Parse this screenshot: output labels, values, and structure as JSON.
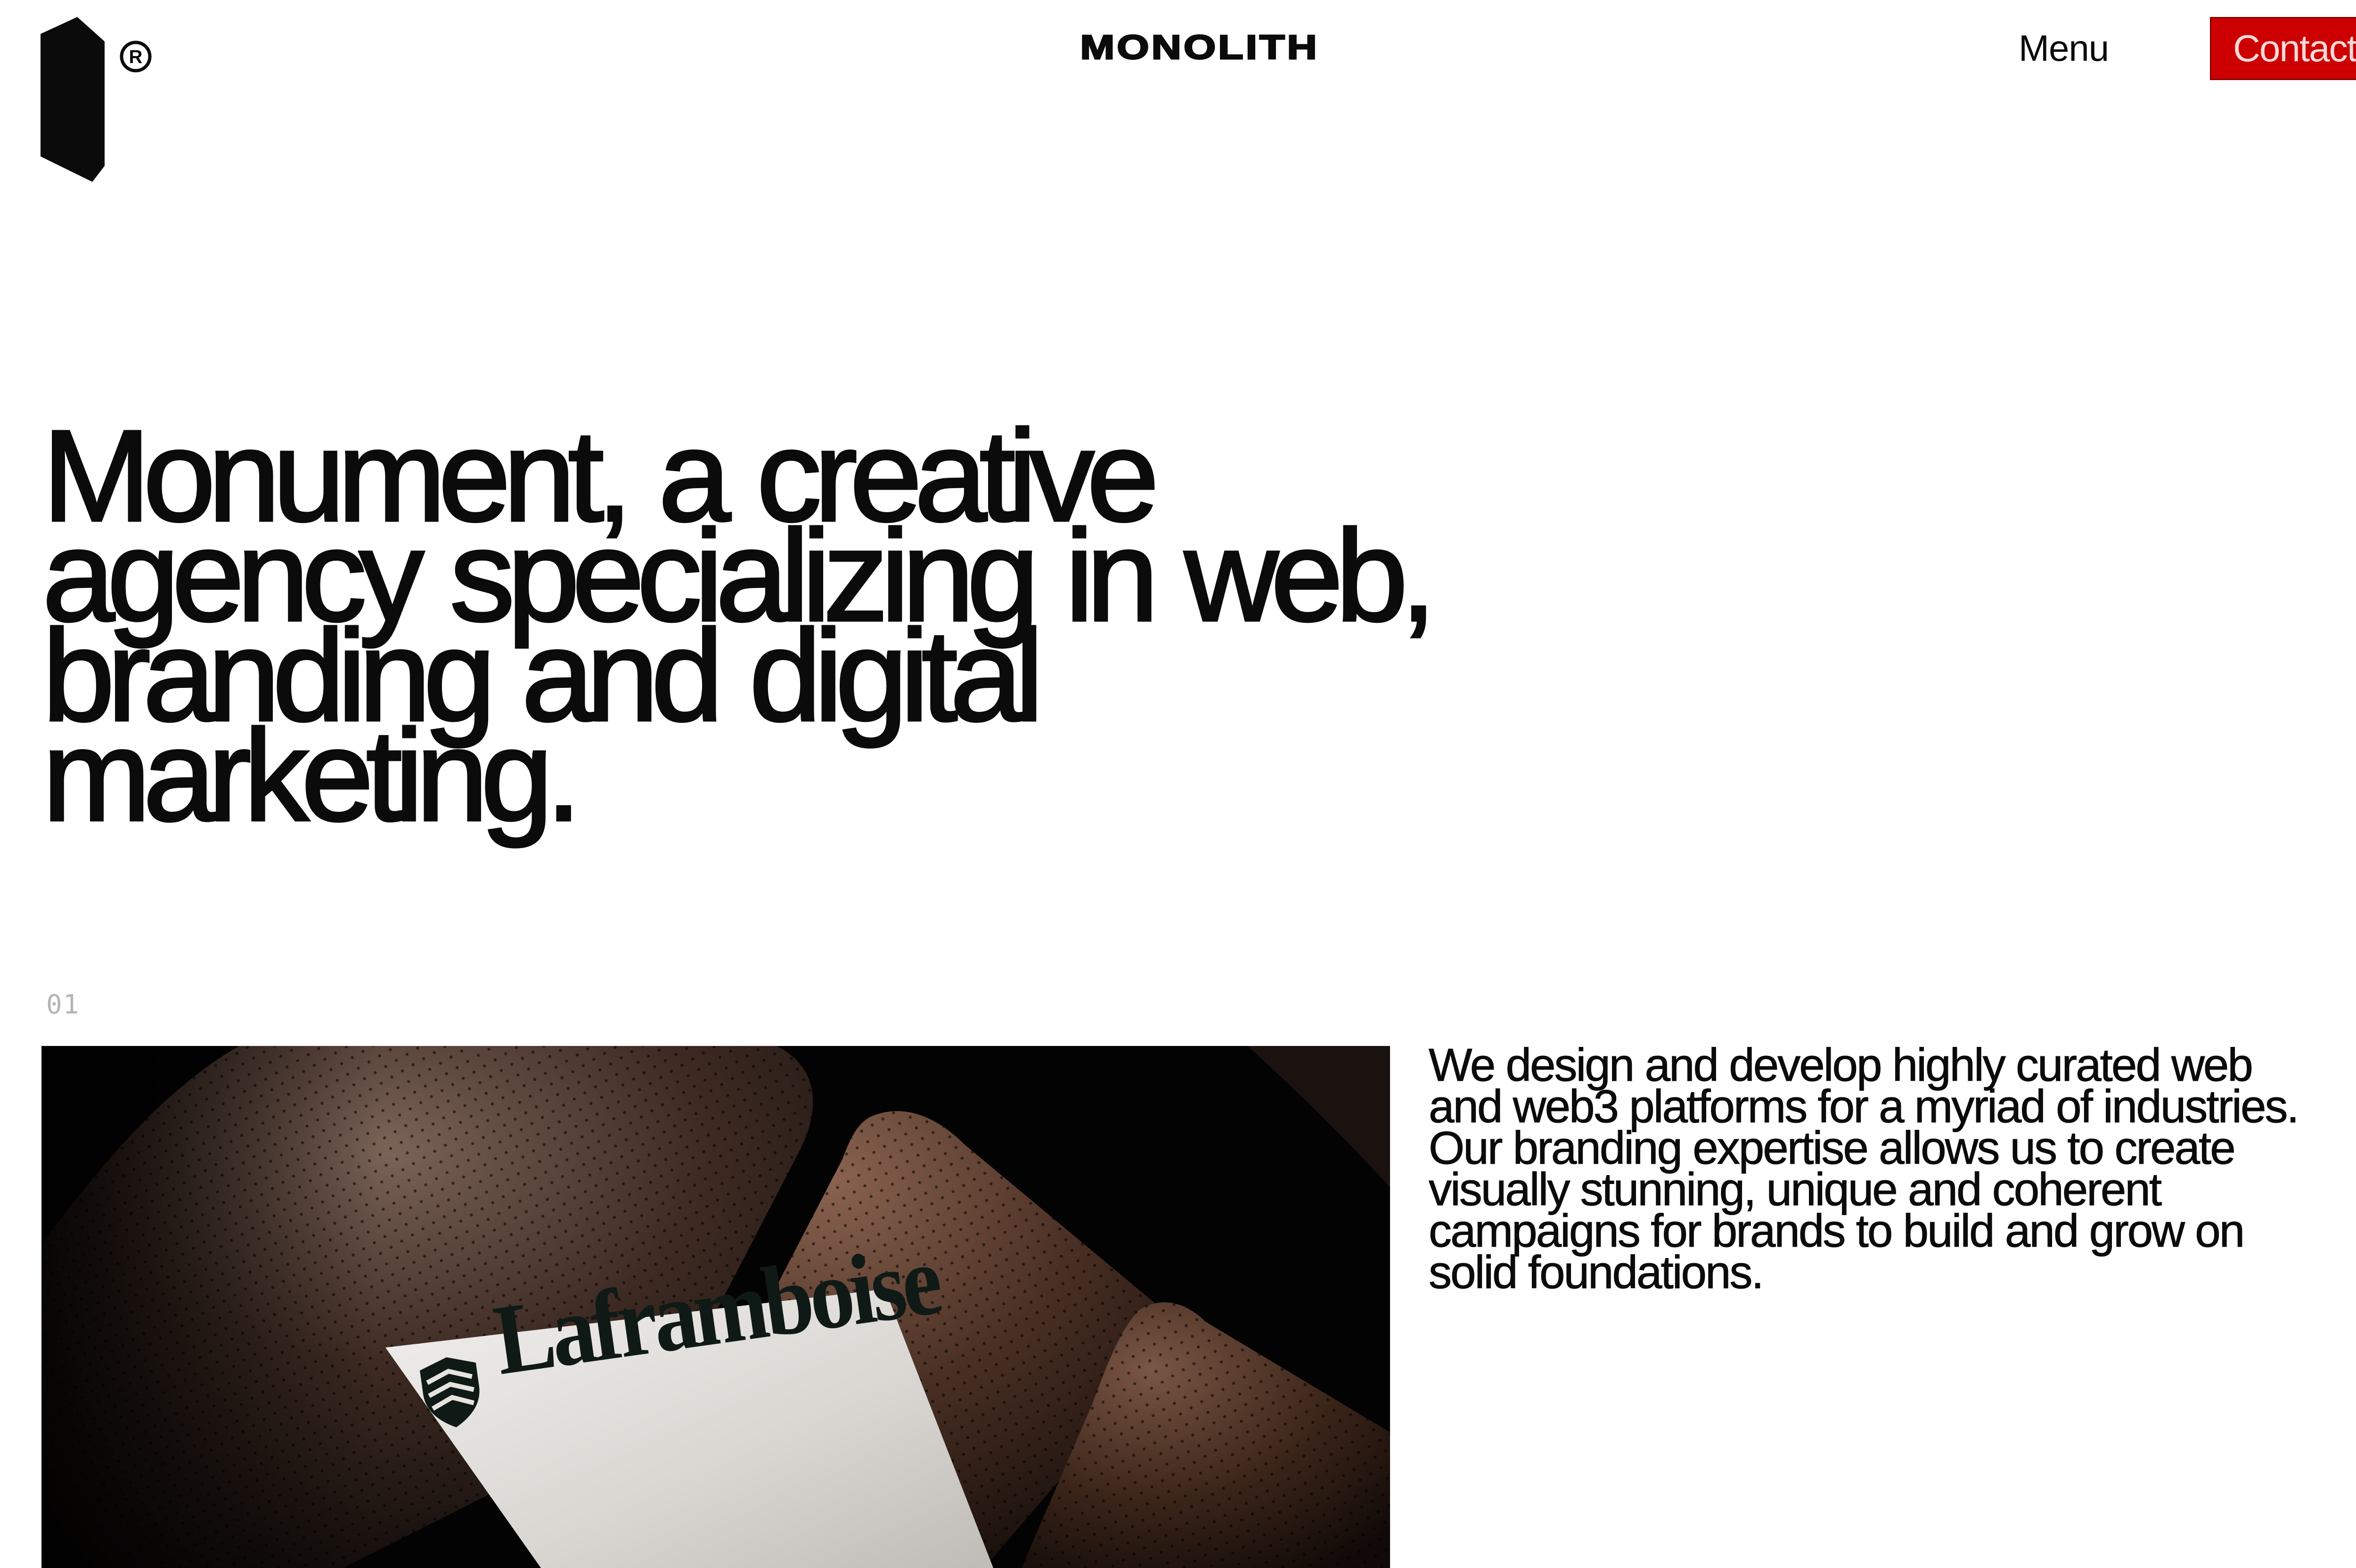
{
  "header": {
    "brand": "MONOLITH",
    "menu_label": "Menu",
    "contact_label": "Contact",
    "logo_icon": "monolith-block-icon",
    "registered_icon": "registered-trademark-icon"
  },
  "hero": {
    "lines": [
      "Monument, a creative",
      "agency specializing in web,",
      "branding and digital",
      "marketing."
    ]
  },
  "section": {
    "index": "01",
    "image": {
      "brand_on_card": "Laframboise",
      "card_icon": "shield-stripes-icon"
    },
    "description_lines": [
      "We design and develop highly curated web",
      "and web3 platforms for a myriad of industries.",
      "Our branding expertise allows us to create",
      "visually stunning, unique and coherent",
      "campaigns for brands to build and grow on",
      "solid foundations."
    ]
  },
  "colors": {
    "background": "#ffffff",
    "text": "#0b0b0b",
    "accent": "#cc0000",
    "muted": "#b5b5b5"
  }
}
